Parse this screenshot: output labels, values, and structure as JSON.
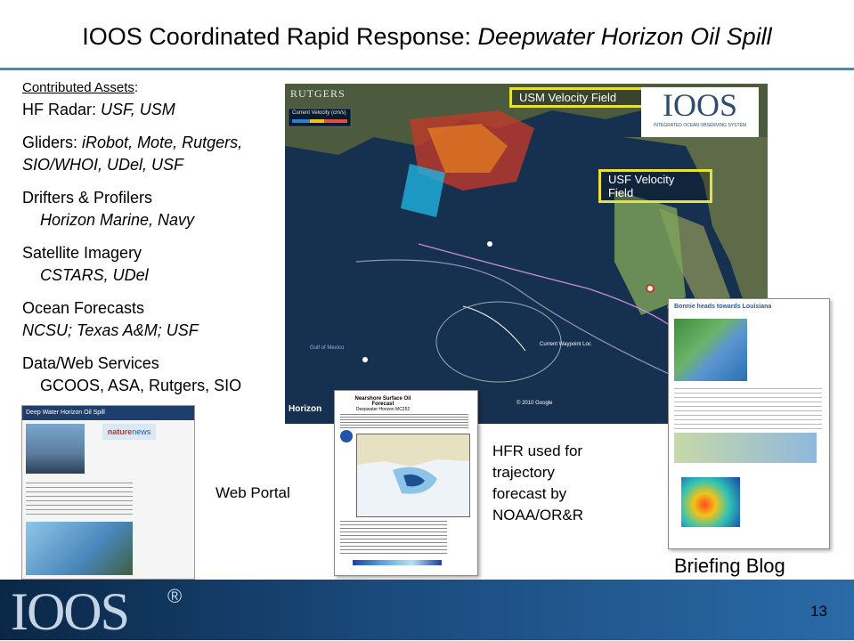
{
  "slide": {
    "title_prefix": "IOOS Coordinated Rapid Response: ",
    "title_italic": "Deepwater Horizon Oil Spill",
    "page_number": "13"
  },
  "assets": {
    "header": "Contributed Assets",
    "header_colon": ":",
    "hf_radar_label": "HF Radar: ",
    "hf_radar_value": "USF, USM",
    "gliders_label": "Gliders: ",
    "gliders_value": "iRobot, Mote, Rutgers, SIO/WHOI, UDel, USF",
    "drifters_label": "Drifters & Profilers",
    "drifters_value": "Horizon Marine, Navy",
    "satellite_label": "Satellite Imagery",
    "satellite_value": "CSTARS, UDel",
    "forecasts_label": "Ocean Forecasts",
    "forecasts_value": "NCSU; Texas A&M; USF",
    "services_label": "Data/Web Services",
    "services_value": "GCOOS, ASA, Rutgers, SIO"
  },
  "map": {
    "usm_callout": "USM Velocity Field",
    "usf_callout": "USF Velocity Field",
    "rutgers_label": "RUTGERS",
    "ioos_mark": "IOOS",
    "ioos_tagline": "INTEGRATED OCEAN OBSERVING SYSTEM",
    "legend_title": "Current Velocity (cm/s)",
    "horizon_label": "Horizon",
    "gulf_label": "Gulf of Mexico",
    "current_waypoint": "Current Waypoint Loc",
    "copyright": "© 2010 Google"
  },
  "captions": {
    "web_portal": "Web Portal",
    "hfr_used": "HFR used for trajectory forecast by NOAA/OR&R",
    "briefing_blog": "Briefing Blog"
  },
  "forecast_doc": {
    "header": "Nearshore Surface Oil Forecast",
    "subheader": "Deepwater Horizon MC252"
  },
  "portal_doc": {
    "banner": "Deep Water Horizon Oil Spill",
    "nature_label": "nature",
    "nature_suffix": "news"
  },
  "blog_doc": {
    "post_title": "Bonnie heads towards Louisiana"
  },
  "footer": {
    "logo_text": "IOOS",
    "registered": "®"
  },
  "colors": {
    "title_rule": "#5b86a6",
    "callout_border": "#e8e13a",
    "footer_dark": "#0a2747",
    "footer_light": "#2a6aa7"
  }
}
